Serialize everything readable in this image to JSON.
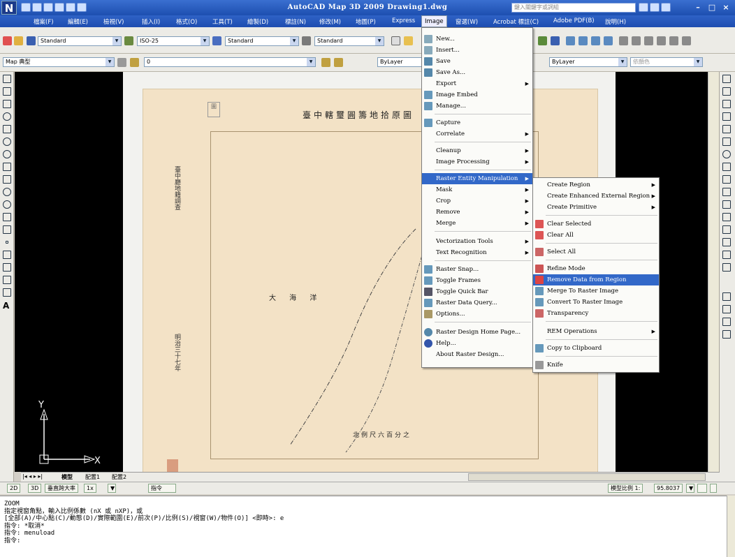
{
  "window": {
    "title": "AutoCAD Map 3D 2009 Drawing1.dwg",
    "logo": "N",
    "search_placeholder": "鍵入關鍵字或詞組",
    "minimize": "–",
    "restore": "□",
    "close": "×"
  },
  "menubar": {
    "items": [
      "檔案(F)",
      "編輯(E)",
      "檢視(V)",
      "插入(I)",
      "格式(O)",
      "工具(T)",
      "繪製(D)",
      "標註(N)",
      "修改(M)",
      "地圖(P)",
      "Express",
      "Image",
      "窗選(W)",
      "Acrobat 標註(C)",
      "Adobe PDF(B)",
      "說明(H)"
    ],
    "active": "Image"
  },
  "toolbar1": {
    "text_style": "Standard",
    "dim_style": "ISO-25",
    "table_style": "Standard",
    "mleader_style": "Standard"
  },
  "toolbar2": {
    "workspace": "Map 典型",
    "layer": "0",
    "color": "ByLayer",
    "linetype": "ByLayer",
    "lineweight": "依顏色"
  },
  "map": {
    "title": "臺中轄璽圓籌地拾原圖",
    "label_sea": "大 海 洋",
    "scale_text": "北例尺六百分之",
    "stamp": "圖"
  },
  "image_menu": {
    "items": [
      {
        "label": "New...",
        "icon": "new-icon"
      },
      {
        "label": "Insert...",
        "icon": "insert-icon"
      },
      {
        "label": "Save",
        "icon": "save-icon"
      },
      {
        "label": "Save As...",
        "icon": "save-as-icon"
      },
      {
        "label": "Export",
        "submenu": true
      },
      {
        "label": "Image Embed",
        "icon": "embed-icon"
      },
      {
        "label": "Manage...",
        "icon": "manage-icon"
      },
      {
        "label": "Capture",
        "icon": "capture-icon"
      },
      {
        "label": "Correlate",
        "submenu": true
      },
      {
        "label": "Cleanup",
        "submenu": true
      },
      {
        "label": "Image Processing",
        "submenu": true
      },
      {
        "label": "Raster Entity Manipulation",
        "submenu": true,
        "highlighted": true
      },
      {
        "label": "Mask",
        "submenu": true
      },
      {
        "label": "Crop",
        "submenu": true
      },
      {
        "label": "Remove",
        "submenu": true
      },
      {
        "label": "Merge",
        "submenu": true
      },
      {
        "label": "Vectorization Tools",
        "submenu": true
      },
      {
        "label": "Text Recognition",
        "submenu": true
      },
      {
        "label": "Raster Snap...",
        "icon": "snap-icon"
      },
      {
        "label": "Toggle Frames",
        "icon": "frames-icon"
      },
      {
        "label": "Toggle Quick Bar",
        "icon": "quickbar-icon"
      },
      {
        "label": "Raster Data Query...",
        "icon": "query-icon"
      },
      {
        "label": "Options...",
        "icon": "options-icon"
      },
      {
        "label": "Raster Design Home Page...",
        "icon": "home-icon"
      },
      {
        "label": "Help...",
        "icon": "help-icon"
      },
      {
        "label": "About Raster Design..."
      }
    ]
  },
  "rem_submenu": {
    "items": [
      {
        "label": "Create Region",
        "submenu": true
      },
      {
        "label": "Create Enhanced External Region",
        "submenu": true
      },
      {
        "label": "Create Primitive",
        "submenu": true
      },
      {
        "label": "Clear Selected",
        "icon": "clear-selected-icon"
      },
      {
        "label": "Clear All",
        "icon": "clear-all-icon"
      },
      {
        "label": "Select All",
        "icon": "select-all-icon"
      },
      {
        "label": "Refine Mode",
        "icon": "refine-icon"
      },
      {
        "label": "Remove Data from Region",
        "icon": "remove-data-icon",
        "highlighted": true
      },
      {
        "label": "Merge To Raster Image",
        "icon": "merge-icon"
      },
      {
        "label": "Convert To Raster Image",
        "icon": "convert-icon"
      },
      {
        "label": "Transparency",
        "icon": "transparency-icon"
      },
      {
        "label": "REM Operations",
        "submenu": true
      },
      {
        "label": "Copy to Clipboard",
        "icon": "clipboard-icon"
      },
      {
        "label": "Knife",
        "icon": "knife-icon"
      }
    ]
  },
  "layout_tabs": {
    "model": "模型",
    "layout1": "配置1",
    "layout2": "配置2"
  },
  "statusbar": {
    "view2d": "2D",
    "view3d": "3D",
    "mode": "垂直跨大率",
    "zoom": "1x",
    "cmd": "指令",
    "scale_label": "模型比例 1:",
    "scale_value": "95.8037"
  },
  "command_lines": [
    "ZOOM",
    "指定視窗角點，輸入比例係數 (nX 或 nXP)，或",
    "[全部(A)/中心點(C)/動態(D)/實際範圍(E)/前次(P)/比例(S)/視窗(W)/物件(O)] <即時>: e",
    "指令: *取消*",
    "指令: menuload",
    "指令:"
  ],
  "ucs": {
    "x": "X",
    "y": "Y"
  }
}
